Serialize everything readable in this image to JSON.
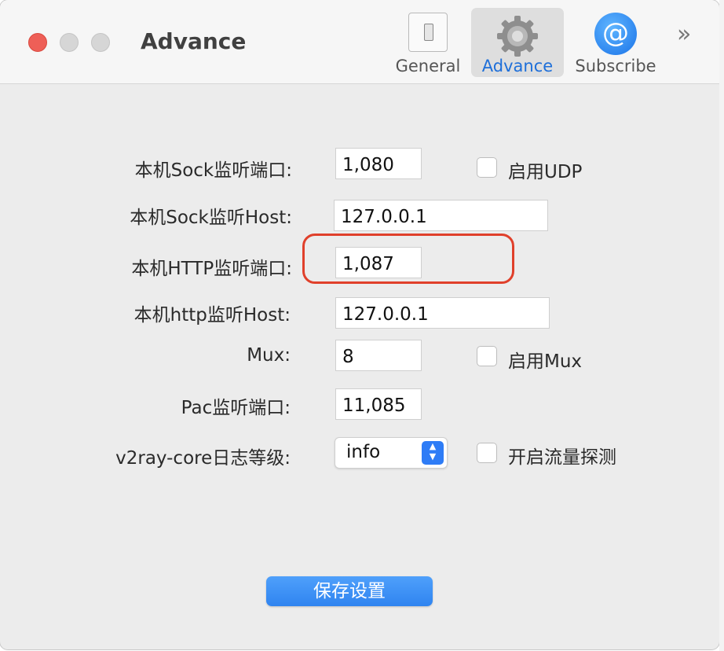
{
  "window": {
    "title": "Advance"
  },
  "toolbar": {
    "tabs": [
      {
        "label": "General",
        "icon": "toggle-switch-icon"
      },
      {
        "label": "Advance",
        "icon": "gear-icon",
        "selected": true
      },
      {
        "label": "Subscribe",
        "icon": "at-sign-icon"
      }
    ],
    "more_glyph": "»"
  },
  "form": {
    "socks_port": {
      "label": "本机Sock监听端口:",
      "value": "1,080"
    },
    "enable_udp": {
      "label": "启用UDP",
      "checked": false
    },
    "socks_host": {
      "label": "本机Sock监听Host:",
      "value": "127.0.0.1"
    },
    "http_port": {
      "label": "本机HTTP监听端口:",
      "value": "1,087"
    },
    "http_host": {
      "label": "本机http监听Host:",
      "value": "127.0.0.1"
    },
    "mux": {
      "label": "Mux:",
      "value": "8"
    },
    "enable_mux": {
      "label": "启用Mux",
      "checked": false
    },
    "pac_port": {
      "label": "Pac监听端口:",
      "value": "11,085"
    },
    "log_level": {
      "label": "v2ray-core日志等级:",
      "value": "info"
    },
    "traffic_detect": {
      "label": "开启流量探测",
      "checked": false
    }
  },
  "actions": {
    "save_label": "保存设置"
  },
  "colors": {
    "accent": "#2e7cf6",
    "annotation": "#e0402b",
    "close": "#ee5f57"
  }
}
